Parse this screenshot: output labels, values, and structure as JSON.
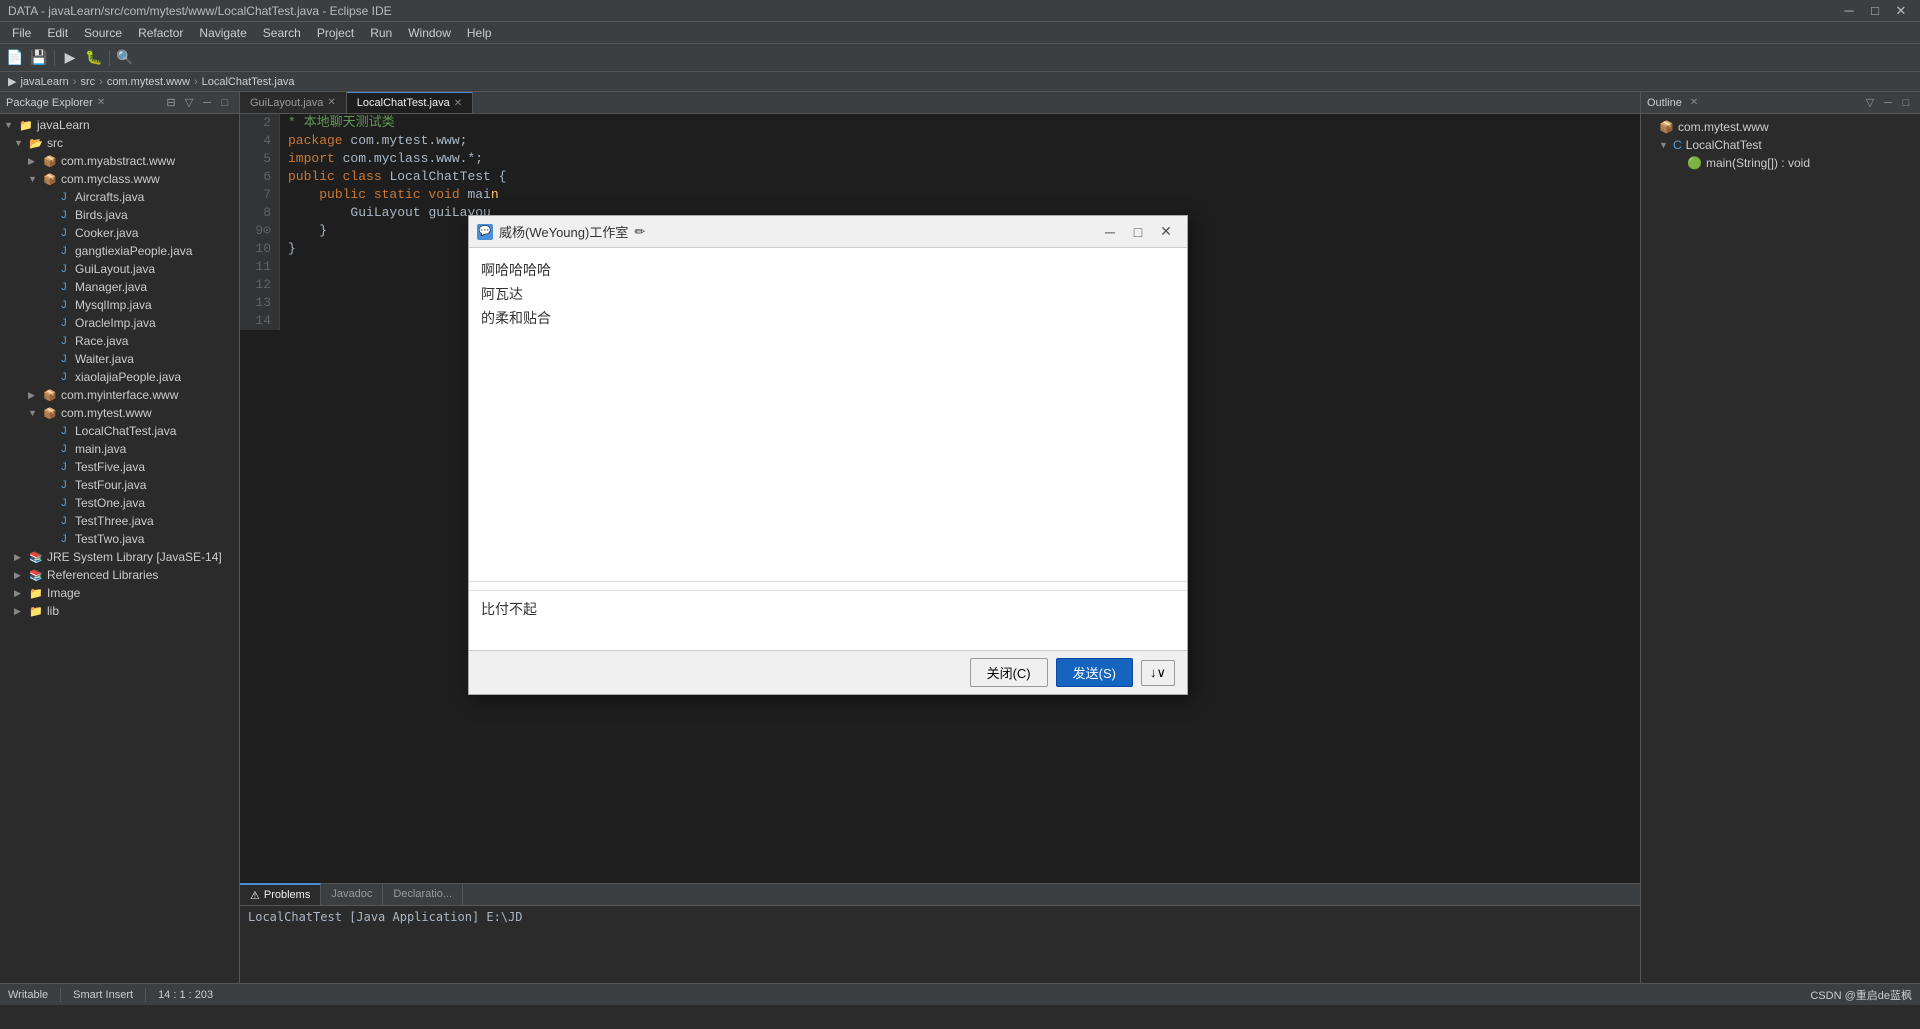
{
  "window": {
    "title": "DATA - javaLearn/src/com/mytest/www/LocalChatTest.java - Eclipse IDE",
    "minimize": "─",
    "maximize": "□",
    "close": "✕"
  },
  "menubar": {
    "items": [
      "File",
      "Edit",
      "Source",
      "Refactor",
      "Navigate",
      "Search",
      "Project",
      "Run",
      "Window",
      "Help"
    ]
  },
  "breadcrumb": {
    "items": [
      "javaLearn",
      "src",
      "com.mytest.www",
      "LocalChatTest.java"
    ]
  },
  "packageExplorer": {
    "title": "Package Explorer",
    "tree": [
      {
        "label": "javaLearn",
        "level": 0,
        "type": "project",
        "expanded": true,
        "arrow": "▼"
      },
      {
        "label": "src",
        "level": 1,
        "type": "src",
        "expanded": true,
        "arrow": "▼"
      },
      {
        "label": "com.myabstract.www",
        "level": 2,
        "type": "package",
        "expanded": false,
        "arrow": "▶"
      },
      {
        "label": "com.myclass.www",
        "level": 2,
        "type": "package",
        "expanded": true,
        "arrow": "▼"
      },
      {
        "label": "Aircrafts.java",
        "level": 3,
        "type": "java",
        "arrow": ""
      },
      {
        "label": "Birds.java",
        "level": 3,
        "type": "java",
        "arrow": ""
      },
      {
        "label": "Cooker.java",
        "level": 3,
        "type": "java",
        "arrow": ""
      },
      {
        "label": "gangtiexiaPeople.java",
        "level": 3,
        "type": "java",
        "arrow": ""
      },
      {
        "label": "GuiLayout.java",
        "level": 3,
        "type": "java",
        "arrow": ""
      },
      {
        "label": "Manager.java",
        "level": 3,
        "type": "java",
        "arrow": ""
      },
      {
        "label": "MysqlImp.java",
        "level": 3,
        "type": "java",
        "arrow": ""
      },
      {
        "label": "OracleImp.java",
        "level": 3,
        "type": "java",
        "arrow": ""
      },
      {
        "label": "Race.java",
        "level": 3,
        "type": "java",
        "arrow": ""
      },
      {
        "label": "Waiter.java",
        "level": 3,
        "type": "java",
        "arrow": ""
      },
      {
        "label": "xiaolajiaPeople.java",
        "level": 3,
        "type": "java",
        "arrow": ""
      },
      {
        "label": "com.myinterface.www",
        "level": 2,
        "type": "package",
        "expanded": false,
        "arrow": "▶"
      },
      {
        "label": "com.mytest.www",
        "level": 2,
        "type": "package",
        "expanded": true,
        "arrow": "▼"
      },
      {
        "label": "LocalChatTest.java",
        "level": 3,
        "type": "java",
        "arrow": ""
      },
      {
        "label": "main.java",
        "level": 3,
        "type": "java",
        "arrow": ""
      },
      {
        "label": "TestFive.java",
        "level": 3,
        "type": "java",
        "arrow": ""
      },
      {
        "label": "TestFour.java",
        "level": 3,
        "type": "java",
        "arrow": ""
      },
      {
        "label": "TestOne.java",
        "level": 3,
        "type": "java",
        "arrow": ""
      },
      {
        "label": "TestThree.java",
        "level": 3,
        "type": "java",
        "arrow": ""
      },
      {
        "label": "TestTwo.java",
        "level": 3,
        "type": "java",
        "arrow": ""
      },
      {
        "label": "JRE System Library [JavaSE-14]",
        "level": 1,
        "type": "library",
        "expanded": false,
        "arrow": "▶"
      },
      {
        "label": "Referenced Libraries",
        "level": 1,
        "type": "library",
        "expanded": false,
        "arrow": "▶"
      },
      {
        "label": "Image",
        "level": 1,
        "type": "folder",
        "expanded": false,
        "arrow": "▶"
      },
      {
        "label": "lib",
        "level": 1,
        "type": "folder",
        "expanded": false,
        "arrow": "▶"
      }
    ]
  },
  "editor": {
    "tabs": [
      {
        "label": "GuiLayout.java",
        "active": false,
        "modified": false
      },
      {
        "label": "LocalChatTest.java",
        "active": true,
        "modified": false
      }
    ],
    "code": [
      {
        "line": 2,
        "text": "* 本地聊天测试类 ",
        "comment": true
      },
      {
        "line": 4,
        "text": "package com.mytest.www;"
      },
      {
        "line": 5,
        "text": "import com.myclass.www.*;"
      },
      {
        "line": 6,
        "text": ""
      },
      {
        "line": 7,
        "text": "public class LocalChatTest {"
      },
      {
        "line": 8,
        "text": ""
      },
      {
        "line": 9,
        "text": "    public static void mai",
        "debug": true
      },
      {
        "line": 10,
        "text": "        GuiLayout guiLayou",
        "debug": true
      },
      {
        "line": 11,
        "text": "    }"
      },
      {
        "line": 12,
        "text": ""
      },
      {
        "line": 13,
        "text": "}"
      },
      {
        "line": 14,
        "text": ""
      }
    ]
  },
  "outline": {
    "title": "Outline",
    "items": [
      {
        "label": "com.mytest.www",
        "level": 0,
        "type": "package"
      },
      {
        "label": "LocalChatTest",
        "level": 1,
        "type": "class",
        "expanded": true
      },
      {
        "label": "main(String[]) : void",
        "level": 2,
        "type": "method"
      }
    ]
  },
  "bottomPanel": {
    "tabs": [
      "Problems",
      "Javadoc",
      "Declaration"
    ],
    "activeTab": 0,
    "content": "LocalChatTest [Java Application] E:\\JD"
  },
  "statusBar": {
    "writable": "Writable",
    "smartInsert": "Smart Insert",
    "position": "14 : 1 : 203",
    "rightText": "CSDN @重启de蓝枫"
  },
  "chatDialog": {
    "title": "威杨(WeYoung)工作室",
    "editIcon": "✏",
    "minimize": "─",
    "maximize": "□",
    "close": "✕",
    "messages": [
      {
        "text": "啊哈哈哈哈"
      },
      {
        "text": "阿瓦达"
      },
      {
        "text": ""
      },
      {
        "text": "的柔和贴合"
      }
    ],
    "inputMessage": "比付不起",
    "closeBtn": "关闭(C)",
    "sendBtn": "发送(S)",
    "sendDropdown": "↓∨"
  }
}
